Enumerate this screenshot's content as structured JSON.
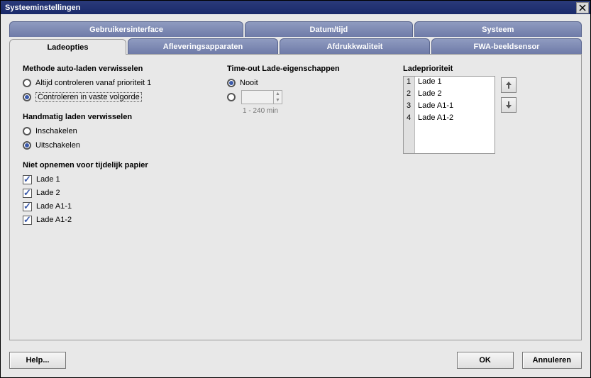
{
  "window": {
    "title": "Systeeminstellingen"
  },
  "tabs_row1": {
    "t1": "Gebruikersinterface",
    "t2": "Datum/tijd",
    "t3": "Systeem"
  },
  "tabs_row2": {
    "t1": "Ladeopties",
    "t2": "Afleveringsapparaten",
    "t3": "Afdrukkwaliteit",
    "t4": "FWA-beeldsensor"
  },
  "auto_switch": {
    "title": "Methode auto-laden verwisselen",
    "opt1": "Altijd controleren vanaf prioriteit 1",
    "opt2": "Controleren in vaste volgorde",
    "selected": "opt2"
  },
  "manual_switch": {
    "title": "Handmatig laden verwisselen",
    "opt1": "Inschakelen",
    "opt2": "Uitschakelen",
    "selected": "opt2"
  },
  "exclude": {
    "title": "Niet opnemen voor tijdelijk papier",
    "items": [
      {
        "label": "Lade 1",
        "checked": true
      },
      {
        "label": "Lade 2",
        "checked": true
      },
      {
        "label": "Lade A1-1",
        "checked": true
      },
      {
        "label": "Lade A1-2",
        "checked": true
      }
    ]
  },
  "timeout": {
    "title": "Time-out Lade-eigenschappen",
    "opt1": "Nooit",
    "hint": "1 - 240 min",
    "selected": "opt1"
  },
  "priority": {
    "title": "Ladeprioriteit",
    "items": [
      "Lade 1",
      "Lade 2",
      "Lade A1-1",
      "Lade A1-2"
    ]
  },
  "buttons": {
    "help": "Help...",
    "ok": "OK",
    "cancel": "Annuleren"
  }
}
